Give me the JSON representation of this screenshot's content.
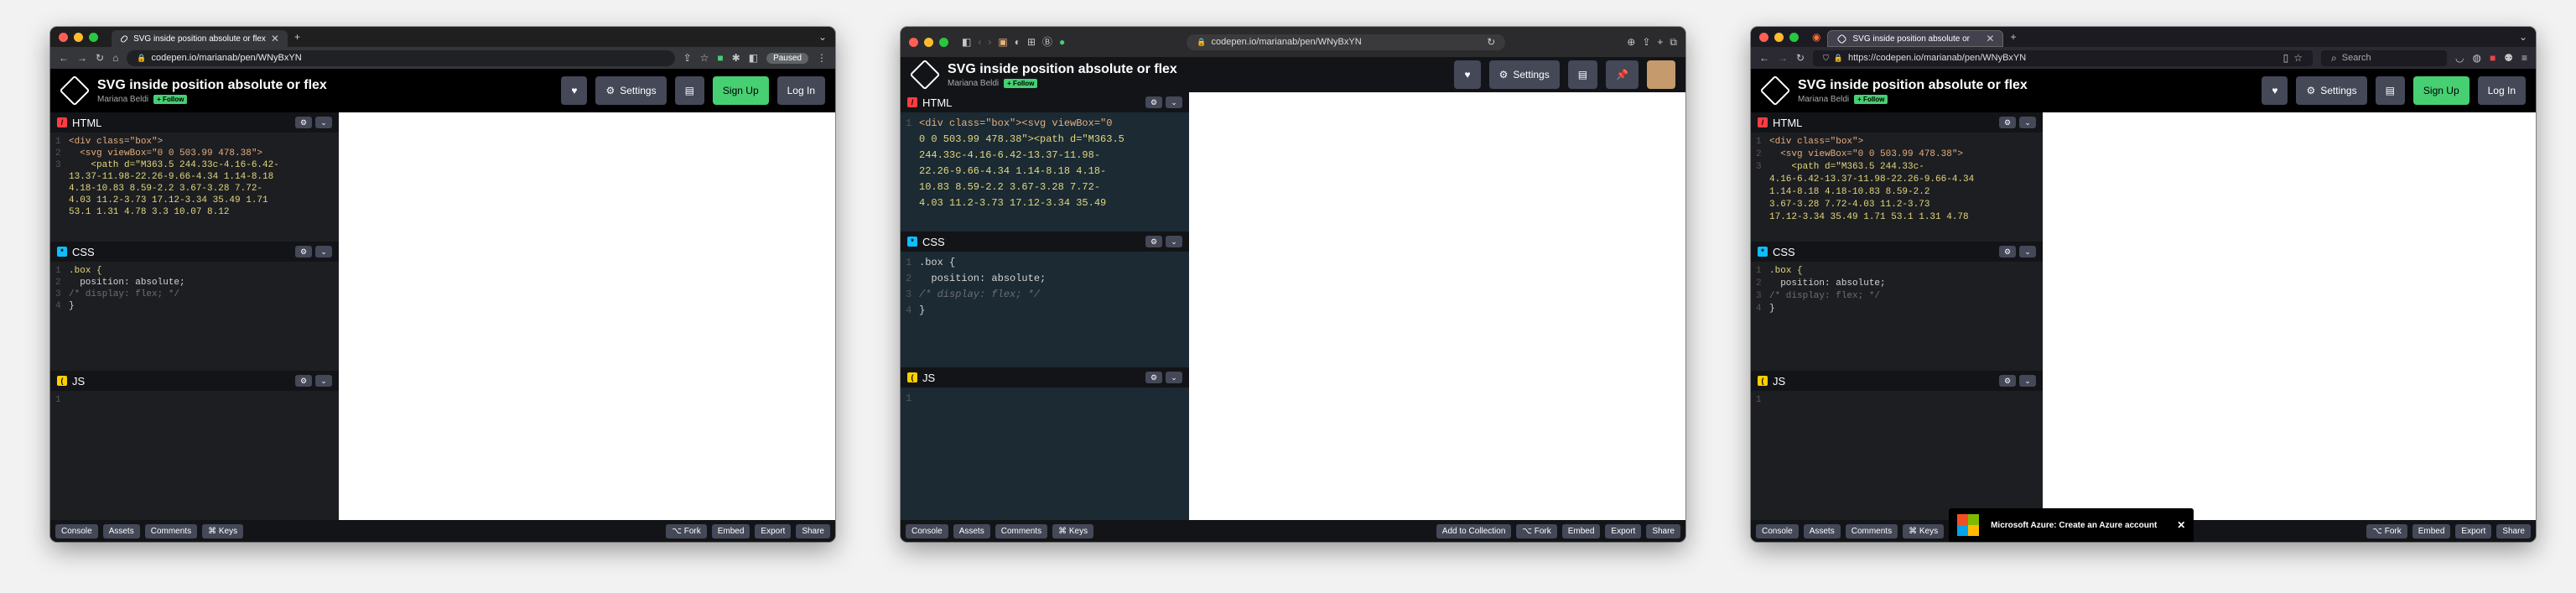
{
  "screens": [
    {
      "browser": "chrome",
      "tab_title": "SVG inside position absolute or flex",
      "url": "codepen.io/marianab/pen/WNyBxYN",
      "extra": "Paused",
      "pen_title": "SVG inside position absolute or flex",
      "author": "Mariana Beldi",
      "follow": "+ Follow",
      "settings": "Settings",
      "signup": "Sign Up",
      "login": "Log In",
      "html_label": "HTML",
      "css_label": "CSS",
      "js_label": "JS",
      "html_lines": [
        "<div class=\"box\">",
        "  <svg viewBox=\"0 0 503.99 478.38\">",
        "    <path d=\"M363.5 244.33c-4.16-6.42-",
        "13.37-11.98-22.26-9.66-4.34 1.14-8.18",
        "4.18-10.83 8.59-2.2 3.67-3.28 7.72-",
        "4.03 11.2-3.73 17.12-3.34 35.49 1.71",
        "53.1 1.31 4.78 3.3 10.07 8.12"
      ],
      "css_lines": [
        ".box {",
        "  position: absolute;",
        "/* display: flex; */",
        "}"
      ],
      "footer_left": [
        "Console",
        "Assets",
        "Comments",
        "⌘ Keys"
      ],
      "footer_right": [
        "⌥ Fork",
        "Embed",
        "Export",
        "Share"
      ],
      "accent": "#47cf73"
    },
    {
      "browser": "safari",
      "tab_title": "",
      "url": "codepen.io/marianab/pen/WNyBxYN",
      "extra": "",
      "pen_title": "SVG inside position absolute or flex",
      "author": "Mariana Beldi",
      "follow": "+ Follow",
      "settings": "Settings",
      "html_label": "HTML",
      "css_label": "CSS",
      "js_label": "JS",
      "html_lines": [
        "<div class=\"box\"><svg viewBox=\"0",
        "0 0 503.99 478.38\"><path d=\"M363.5",
        "244.33c-4.16-6.42-13.37-11.98-",
        "22.26-9.66-4.34 1.14-8.18 4.18-",
        "10.83 8.59-2.2 3.67-3.28 7.72-",
        "4.03 11.2-3.73 17.12-3.34 35.49"
      ],
      "css_lines": [
        ".box {",
        "  position: absolute;",
        "/* display: flex; */",
        "}"
      ],
      "footer_left": [
        "Console",
        "Assets",
        "Comments",
        "⌘ Keys"
      ],
      "footer_right": [
        "Add to Collection",
        "⌥ Fork",
        "Embed",
        "Export",
        "Share"
      ],
      "accent": "#47cf73"
    },
    {
      "browser": "firefox",
      "tab_title": "SVG inside position absolute or",
      "url": "https://codepen.io/marianab/pen/WNyBxYN",
      "search": "Search",
      "pen_title": "SVG inside position absolute or flex",
      "author": "Mariana Beldi",
      "follow": "+ Follow",
      "settings": "Settings",
      "signup": "Sign Up",
      "login": "Log In",
      "html_label": "HTML",
      "css_label": "CSS",
      "js_label": "JS",
      "html_lines": [
        "<div class=\"box\">",
        "  <svg viewBox=\"0 0 503.99 478.38\">",
        "    <path d=\"M363.5 244.33c-",
        "4.16-6.42-13.37-11.98-22.26-9.66-4.34",
        "1.14-8.18 4.18-10.83 8.59-2.2",
        "3.67-3.28 7.72-4.03 11.2-3.73",
        "17.12-3.34 35.49 1.71 53.1 1.31 4.78"
      ],
      "css_lines": [
        ".box {",
        "  position: absolute;",
        "/* display: flex; */",
        "}"
      ],
      "footer_left": [
        "Console",
        "Assets",
        "Comments",
        "⌘ Keys"
      ],
      "footer_right": [
        "⌥ Fork",
        "Embed",
        "Export",
        "Share"
      ],
      "toast": "Microsoft Azure: Create an Azure account",
      "accent": "#47cf73"
    }
  ]
}
